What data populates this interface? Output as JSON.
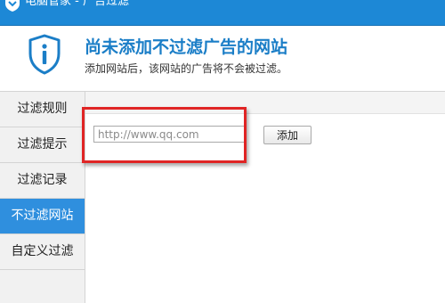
{
  "window": {
    "title": "电脑管家 - 广告过滤"
  },
  "header": {
    "title": "尚未添加不过滤广告的网站",
    "subtitle": "添加网站后，该网站的广告将不会被过滤。",
    "icon": "shield-info-icon"
  },
  "sidebar": {
    "items": [
      {
        "label": "过滤规则",
        "active": false
      },
      {
        "label": "过滤提示",
        "active": false
      },
      {
        "label": "过滤记录",
        "active": false
      },
      {
        "label": "不过滤网站",
        "active": true
      },
      {
        "label": "自定义过滤",
        "active": false
      }
    ]
  },
  "main": {
    "url_placeholder": "http://www.qq.com",
    "url_value": "",
    "add_label": "添加"
  },
  "colors": {
    "accent": "#1d88d6",
    "active_item": "#2f8fde",
    "highlight": "#e02525"
  }
}
